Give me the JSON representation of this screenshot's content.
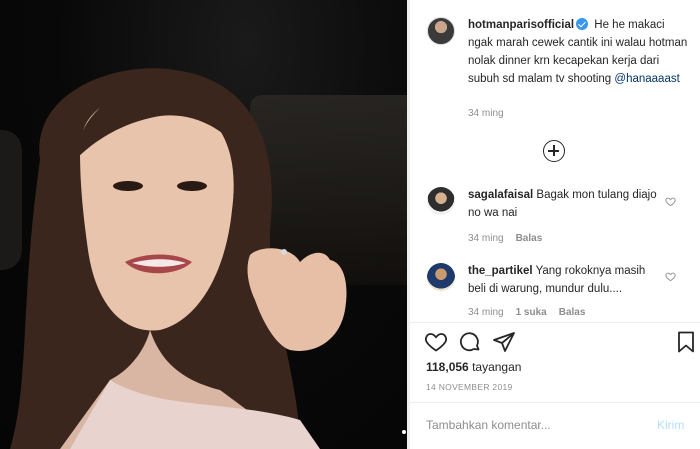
{
  "post": {
    "username": "hotmanparisofficial",
    "caption": "He he makaci ngak marah cewek cantik ini walau hotman nolak dinner krn kecapekan kerja dari subuh sd malam tv shooting",
    "mention": "@hanaaaast",
    "caption_time": "34 ming"
  },
  "comments": [
    {
      "username": "sagalafaisal",
      "text": "Bagak mon tulang diajo no wa nai",
      "time": "34 ming",
      "likes": "",
      "reply": "Balas"
    },
    {
      "username": "the_partikel",
      "text": "Yang rokoknya masih beli di warung, mundur dulu....",
      "time": "34 ming",
      "likes": "1 suka",
      "reply": "Balas"
    }
  ],
  "stats": {
    "views_count": "118,056",
    "views_label": "tayangan",
    "date": "14 NOVEMBER 2019"
  },
  "composer": {
    "placeholder": "Tambahkan komentar...",
    "post_label": "Kirim"
  },
  "icons": {
    "verified": "verified-badge-icon",
    "load_more": "plus-circle-icon",
    "like": "heart-icon",
    "comment": "comment-bubble-icon",
    "share": "paper-plane-icon",
    "save": "bookmark-icon"
  },
  "colors": {
    "verified": "#3897f0",
    "muted": "#8e8e8e",
    "mention": "#003569",
    "post_disabled": "#b2dffc"
  }
}
